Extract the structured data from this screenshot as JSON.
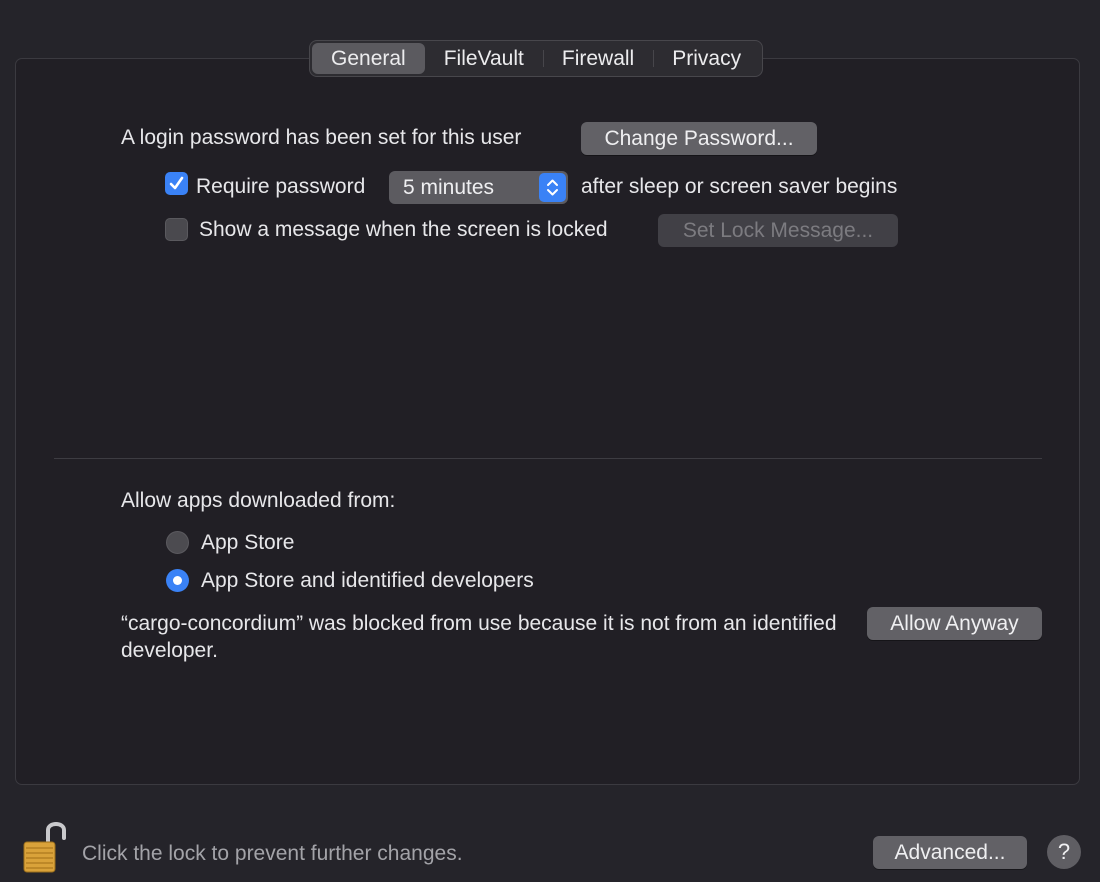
{
  "tabs": [
    {
      "label": "General",
      "active": true
    },
    {
      "label": "FileVault",
      "active": false
    },
    {
      "label": "Firewall",
      "active": false
    },
    {
      "label": "Privacy",
      "active": false
    }
  ],
  "general": {
    "login_text": "A login password has been set for this user",
    "change_password_label": "Change Password...",
    "require_password": {
      "checked": true,
      "label": "Require password",
      "delay_value": "5 minutes",
      "suffix": "after sleep or screen saver begins"
    },
    "show_message": {
      "checked": false,
      "label": "Show a message when the screen is locked",
      "button_label": "Set Lock Message..."
    }
  },
  "downloads": {
    "heading": "Allow apps downloaded from:",
    "options": [
      {
        "label": "App Store",
        "selected": false
      },
      {
        "label": "App Store and identified developers",
        "selected": true
      }
    ],
    "blocked_message": "“cargo-concordium” was blocked from use because it is not from an identified developer.",
    "allow_anyway_label": "Allow Anyway"
  },
  "footer": {
    "lock_text": "Click the lock to prevent further changes.",
    "advanced_label": "Advanced...",
    "help_label": "?"
  },
  "colors": {
    "accent": "#3a82f6",
    "background": "#25242a",
    "panel": "#211f25"
  }
}
